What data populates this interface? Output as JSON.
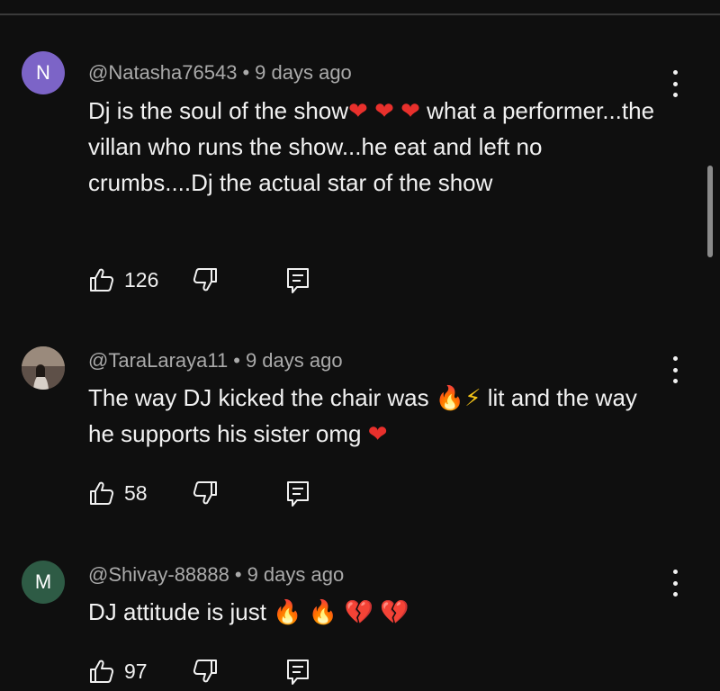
{
  "comments": [
    {
      "avatar_letter": "N",
      "avatar_color": "#7c64c7",
      "handle": "@Natasha76543",
      "separator": "•",
      "time": "9 days ago",
      "text_part1": "Dj is the soul of the show",
      "emojis1": [
        "❤",
        "❤",
        "❤"
      ],
      "text_part2": "what a performer...the villan who runs the show...he eat and left no crumbs....Dj the actual star of the show",
      "likes": "126"
    },
    {
      "avatar_icon": "profile-photo-icon",
      "handle": "@TaraLaraya11",
      "separator": "•",
      "time": "9 days ago",
      "text_part1": "The way DJ kicked the chair was",
      "emojis1": [
        "🔥",
        "⚡"
      ],
      "text_part2": "lit and the way he supports his sister omg",
      "emojis2": [
        "❤"
      ],
      "likes": "58"
    },
    {
      "avatar_letter": "M",
      "avatar_color": "#2e5b45",
      "handle": "@Shivay-88888",
      "separator": "•",
      "time": "9 days ago",
      "text_part1": "DJ attitude is just",
      "emojis1": [
        "🔥",
        "🔥",
        "💔",
        "💔"
      ],
      "likes": "97"
    }
  ],
  "icons": {
    "like": "thumbs-up-icon",
    "dislike": "thumbs-down-icon",
    "reply": "reply-icon",
    "more": "more-vertical-icon"
  }
}
